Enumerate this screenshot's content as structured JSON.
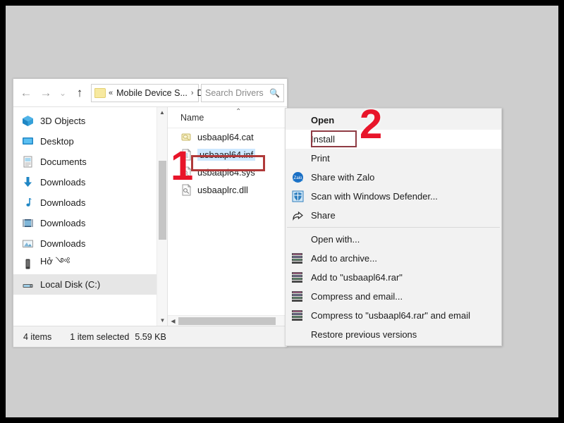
{
  "window": {
    "search": {
      "placeholder": "Search Drivers",
      "icon": "search-icon"
    },
    "address": {
      "chevrons": "«",
      "crumb1": "Mobile Device S...",
      "separator": "›",
      "crumb2": "Drivers",
      "dropdown_icon": "⌄",
      "refresh_icon": "↻"
    },
    "nav_buttons": {
      "back": "←",
      "forward": "→",
      "recent": "⌄",
      "up": "↑"
    }
  },
  "sidebar": {
    "items": [
      {
        "label": "3D Objects",
        "icon": "3d-objects-icon",
        "selected": false
      },
      {
        "label": "Desktop",
        "icon": "desktop-icon",
        "selected": false
      },
      {
        "label": "Documents",
        "icon": "documents-icon",
        "selected": false
      },
      {
        "label": "Downloads",
        "icon": "downloads-icon",
        "selected": false
      },
      {
        "label": "Downloads",
        "icon": "music-icon",
        "selected": false
      },
      {
        "label": "Downloads",
        "icon": "videos-icon",
        "selected": false
      },
      {
        "label": "Downloads",
        "icon": "pictures-icon",
        "selected": false
      },
      {
        "label": "Hở ༺",
        "icon": "device-icon",
        "selected": false
      },
      {
        "label": "Local Disk (C:)",
        "icon": "local-disk-icon",
        "selected": true
      }
    ]
  },
  "filelist": {
    "column_header": "Name",
    "sort_caret": "⌃",
    "rows": [
      {
        "name": "usbaapl64.cat",
        "icon": "catalog-file-icon",
        "selected": false
      },
      {
        "name": "usbaapl64.inf",
        "icon": "inf-file-icon",
        "selected": true
      },
      {
        "name": "usbaapl64.sys",
        "icon": "sys-file-icon",
        "selected": false
      },
      {
        "name": "usbaaplrc.dll",
        "icon": "dll-file-icon",
        "selected": false
      }
    ]
  },
  "statusbar": {
    "items_count": "4 items",
    "selection": "1 item selected",
    "size": "5.59 KB"
  },
  "context_menu": {
    "items": [
      {
        "label": "Open",
        "icon": "",
        "bold": true,
        "hover": false,
        "separator_after": false
      },
      {
        "label": "Install",
        "icon": "",
        "bold": false,
        "hover": true,
        "separator_after": false
      },
      {
        "label": "Print",
        "icon": "",
        "bold": false,
        "hover": false,
        "separator_after": false
      },
      {
        "label": "Share with Zalo",
        "icon": "zalo-icon",
        "bold": false,
        "hover": false,
        "separator_after": false
      },
      {
        "label": "Scan with Windows Defender...",
        "icon": "defender-icon",
        "bold": false,
        "hover": false,
        "separator_after": false
      },
      {
        "label": "Share",
        "icon": "share-icon",
        "bold": false,
        "hover": false,
        "separator_after": true
      },
      {
        "label": "Open with...",
        "icon": "",
        "bold": false,
        "hover": false,
        "separator_after": false
      },
      {
        "label": "Add to archive...",
        "icon": "winrar-icon",
        "bold": false,
        "hover": false,
        "separator_after": false
      },
      {
        "label": "Add to \"usbaapl64.rar\"",
        "icon": "winrar-icon",
        "bold": false,
        "hover": false,
        "separator_after": false
      },
      {
        "label": "Compress and email...",
        "icon": "winrar-icon",
        "bold": false,
        "hover": false,
        "separator_after": false
      },
      {
        "label": "Compress to \"usbaapl64.rar\" and email",
        "icon": "winrar-icon",
        "bold": false,
        "hover": false,
        "separator_after": false
      },
      {
        "label": "Restore previous versions",
        "icon": "",
        "bold": false,
        "hover": false,
        "separator_after": true
      }
    ]
  },
  "annotations": {
    "marker_1": "1",
    "marker_2": "2",
    "highlight_color": "#b03a3a",
    "marker_color": "#e8152a"
  }
}
